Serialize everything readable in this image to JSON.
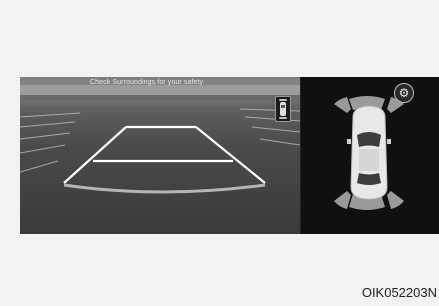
{
  "camera": {
    "warning_text": "Check Surroundings for your safety"
  },
  "icons": {
    "settings": "gear-icon",
    "mini_car": "car-top-icon",
    "vehicle": "car-top-view-icon"
  },
  "figure_code": "OIK052203N"
}
